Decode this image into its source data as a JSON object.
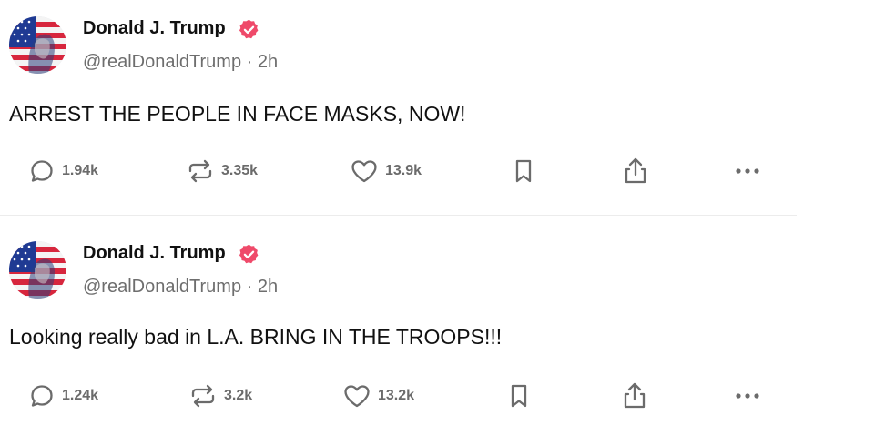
{
  "colors": {
    "verified_badge": "#ef4a6a",
    "text_primary": "#111111",
    "text_secondary": "#6e6e6e",
    "icon_gray": "#6b6b6b",
    "divider": "#ececec"
  },
  "posts": [
    {
      "author": {
        "display_name": "Donald J. Trump",
        "handle": "@realDonaldTrump",
        "separator": "·",
        "time": "2h",
        "avatar_icon": "flag-portrait-avatar",
        "verified_icon": "verified-badge-icon"
      },
      "text": "ARREST THE PEOPLE IN FACE MASKS, NOW!",
      "actions": {
        "replies": "1.94k",
        "reposts": "3.35k",
        "likes": "13.9k"
      }
    },
    {
      "author": {
        "display_name": "Donald J. Trump",
        "handle": "@realDonaldTrump",
        "separator": "·",
        "time": "2h",
        "avatar_icon": "flag-portrait-avatar",
        "verified_icon": "verified-badge-icon"
      },
      "text": "Looking really bad in L.A. BRING IN THE TROOPS!!!",
      "actions": {
        "replies": "1.24k",
        "reposts": "3.2k",
        "likes": "13.2k"
      }
    }
  ]
}
